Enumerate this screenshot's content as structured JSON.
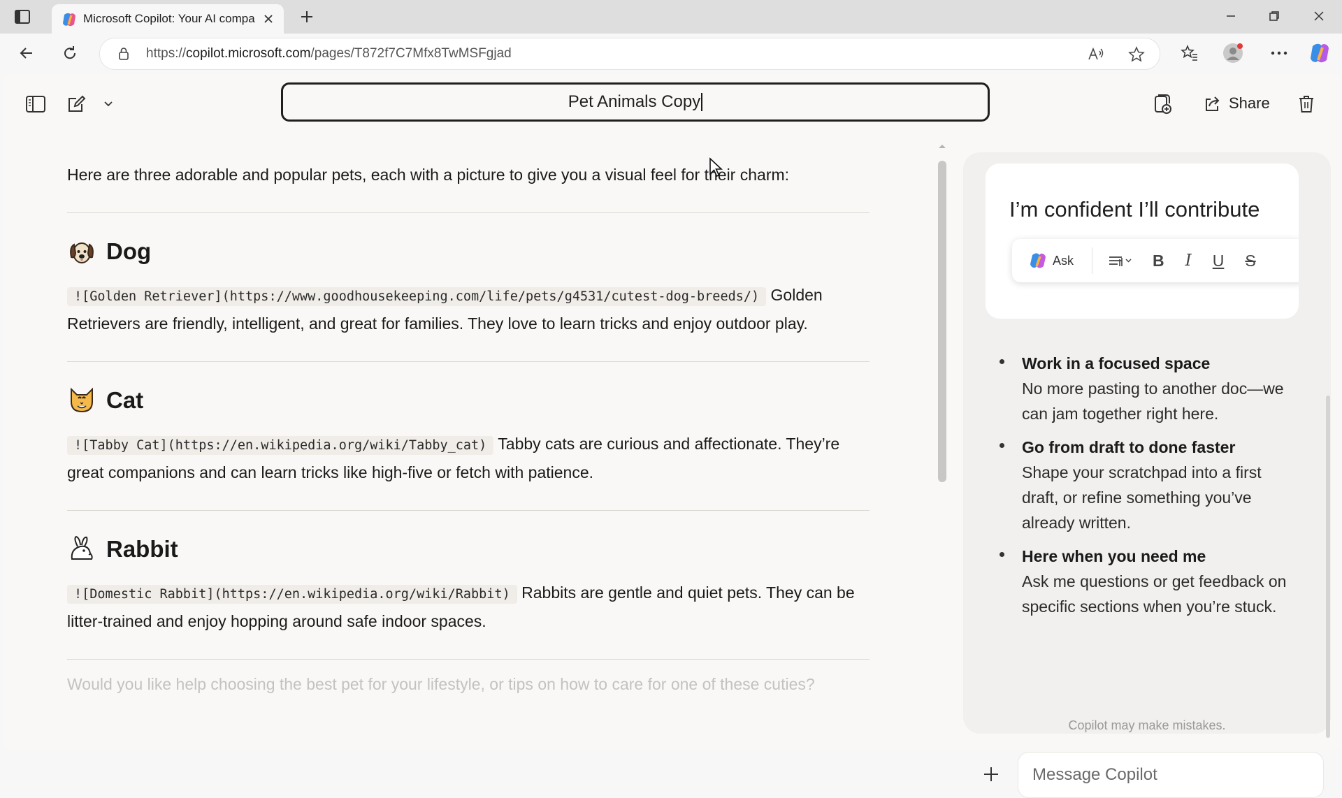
{
  "browser": {
    "tab_title": "Microsoft Copilot: Your AI compa",
    "url_prefix": "https://",
    "url_domain": "copilot.microsoft.com",
    "url_path": "/pages/T872f7C7Mfx8TwMSFgjad"
  },
  "toolbar": {
    "page_title": "Pet Animals Copy",
    "share_label": "Share"
  },
  "document": {
    "intro": "Here are three adorable and popular pets, each with a picture to give you a visual feel for their charm:",
    "pets": [
      {
        "icon": "dog-face-icon",
        "name": "Dog",
        "image_markdown": "![Golden Retriever](https://www.goodhousekeeping.com/life/pets/g4531/cutest-dog-breeds/)",
        "description": "Golden Retrievers are friendly, intelligent, and great for families. They love to learn tricks and enjoy outdoor play."
      },
      {
        "icon": "cat-face-icon",
        "name": "Cat",
        "image_markdown": "![Tabby Cat](https://en.wikipedia.org/wiki/Tabby_cat)",
        "description": "Tabby cats are curious and affectionate. They’re great companions and can learn tricks like high-five or fetch with patience."
      },
      {
        "icon": "rabbit-icon",
        "name": "Rabbit",
        "image_markdown": "![Domestic Rabbit](https://en.wikipedia.org/wiki/Rabbit)",
        "description": "Rabbits are gentle and quiet pets. They can be litter-trained and enjoy hopping around safe indoor spaces."
      }
    ],
    "closing": "Would you like help choosing the best pet for your lifestyle, or tips on how to care for one of these cuties?"
  },
  "copilot_panel": {
    "preview_text": "I’m confident I’ll contribute",
    "ask_label": "Ask",
    "features": [
      {
        "title": "Work in a focused space",
        "desc": "No more pasting to another doc—we can jam together right here."
      },
      {
        "title": "Go from draft to done faster",
        "desc": "Shape your scratchpad into a first draft, or refine something you’ve already written."
      },
      {
        "title": "Here when you need me",
        "desc": "Ask me questions or get feedback on specific sections when you’re stuck."
      }
    ],
    "disclaimer": "Copilot may make mistakes.",
    "input_placeholder": "Message Copilot"
  }
}
